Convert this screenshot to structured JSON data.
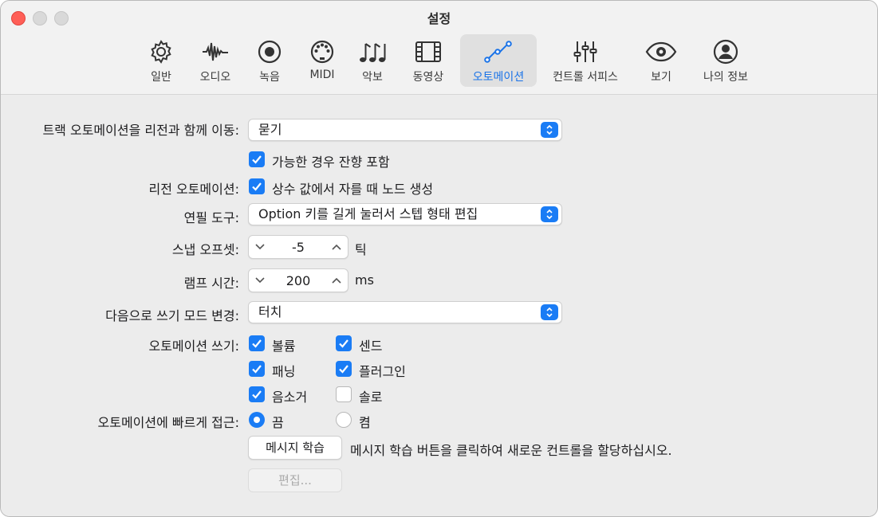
{
  "window": {
    "title": "설정"
  },
  "tabs": [
    {
      "label": "일반",
      "icon": "gear-icon"
    },
    {
      "label": "오디오",
      "icon": "waveform-icon"
    },
    {
      "label": "녹음",
      "icon": "record-icon"
    },
    {
      "label": "MIDI",
      "icon": "midi-icon"
    },
    {
      "label": "악보",
      "icon": "music-notes-icon"
    },
    {
      "label": "동영상",
      "icon": "film-icon"
    },
    {
      "label": "오토메이션",
      "icon": "automation-curve-icon",
      "active": true
    },
    {
      "label": "컨트롤 서피스",
      "icon": "sliders-icon"
    },
    {
      "label": "보기",
      "icon": "eye-icon"
    },
    {
      "label": "나의 정보",
      "icon": "person-icon"
    }
  ],
  "settings": {
    "move_automation": {
      "label": "트랙 오토메이션을 리전과 함께 이동:",
      "value": "묻기"
    },
    "include_tail": {
      "label": "가능한 경우 잔향 포함",
      "checked": true
    },
    "region_automation": {
      "label": "리전 오토메이션:",
      "option": "상수 값에서 자를 때 노드 생성",
      "checked": true
    },
    "pencil_tool": {
      "label": "연필 도구:",
      "value": "Option 키를 길게 눌러서 스텝 형태 편집"
    },
    "snap_offset": {
      "label": "스냅 오프셋:",
      "value": "-5",
      "unit": "틱"
    },
    "ramp_time": {
      "label": "램프 시간:",
      "value": "200",
      "unit": "ms"
    },
    "write_mode_change": {
      "label": "다음으로 쓰기 모드 변경:",
      "value": "터치"
    },
    "automation_write": {
      "label": "오토메이션 쓰기:",
      "volume": {
        "label": "볼륨",
        "checked": true
      },
      "send": {
        "label": "센드",
        "checked": true
      },
      "pan": {
        "label": "패닝",
        "checked": true
      },
      "plugin": {
        "label": "플러그인",
        "checked": true
      },
      "mute": {
        "label": "음소거",
        "checked": true
      },
      "solo": {
        "label": "솔로",
        "checked": false
      }
    },
    "quick_access": {
      "label": "오토메이션에 빠르게 접근:",
      "off": {
        "label": "끔",
        "selected": true
      },
      "on": {
        "label": "켬",
        "selected": false
      }
    },
    "learn": {
      "button": "메시지 학습",
      "hint": "메시지 학습 버튼을 클릭하여 새로운 컨트롤을 할당하십시오."
    },
    "edit_button": "편집..."
  },
  "colors": {
    "accent": "#1a7cf5",
    "close": "#ff5f57"
  }
}
